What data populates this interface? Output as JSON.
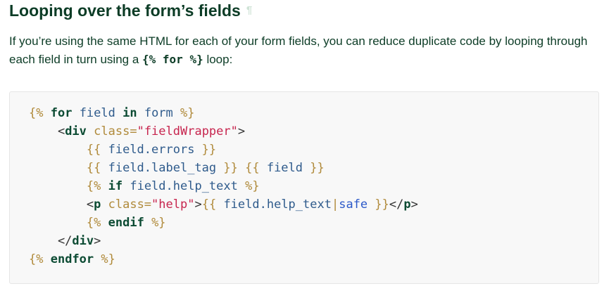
{
  "heading": {
    "text": "Looping over the form’s fields",
    "pilcrow": "¶"
  },
  "paragraph": {
    "before": "If you’re using the same HTML for each of your form fields, you can reduce duplicate code by looping through each field in turn using a ",
    "code": "{% for %}",
    "after": " loop:"
  },
  "code_lines": [
    [
      {
        "t": "tag",
        "v": "{%"
      },
      {
        "t": "txt",
        "v": " "
      },
      {
        "t": "kw",
        "v": "for"
      },
      {
        "t": "txt",
        "v": " field "
      },
      {
        "t": "kw",
        "v": "in"
      },
      {
        "t": "txt",
        "v": " form "
      },
      {
        "t": "tag",
        "v": "%}"
      }
    ],
    [
      {
        "t": "html",
        "v": "    <"
      },
      {
        "t": "el",
        "v": "div"
      },
      {
        "t": "html",
        "v": " "
      },
      {
        "t": "attr",
        "v": "class="
      },
      {
        "t": "str",
        "v": "\"fieldWrapper\""
      },
      {
        "t": "html",
        "v": ">"
      }
    ],
    [
      {
        "t": "txt",
        "v": "        "
      },
      {
        "t": "tag",
        "v": "{{"
      },
      {
        "t": "txt",
        "v": " field.errors "
      },
      {
        "t": "tag",
        "v": "}}"
      }
    ],
    [
      {
        "t": "txt",
        "v": "        "
      },
      {
        "t": "tag",
        "v": "{{"
      },
      {
        "t": "txt",
        "v": " field.label_tag "
      },
      {
        "t": "tag",
        "v": "}}"
      },
      {
        "t": "txt",
        "v": " "
      },
      {
        "t": "tag",
        "v": "{{"
      },
      {
        "t": "txt",
        "v": " field "
      },
      {
        "t": "tag",
        "v": "}}"
      }
    ],
    [
      {
        "t": "txt",
        "v": "        "
      },
      {
        "t": "tag",
        "v": "{%"
      },
      {
        "t": "txt",
        "v": " "
      },
      {
        "t": "kw",
        "v": "if"
      },
      {
        "t": "txt",
        "v": " field.help_text "
      },
      {
        "t": "tag",
        "v": "%}"
      }
    ],
    [
      {
        "t": "html",
        "v": "        <"
      },
      {
        "t": "el",
        "v": "p"
      },
      {
        "t": "html",
        "v": " "
      },
      {
        "t": "attr",
        "v": "class="
      },
      {
        "t": "str",
        "v": "\"help\""
      },
      {
        "t": "html",
        "v": ">"
      },
      {
        "t": "tag",
        "v": "{{"
      },
      {
        "t": "txt",
        "v": " field.help_text"
      },
      {
        "t": "tag",
        "v": "|"
      },
      {
        "t": "filter",
        "v": "safe"
      },
      {
        "t": "txt",
        "v": " "
      },
      {
        "t": "tag",
        "v": "}}"
      },
      {
        "t": "html",
        "v": "</"
      },
      {
        "t": "el",
        "v": "p"
      },
      {
        "t": "html",
        "v": ">"
      }
    ],
    [
      {
        "t": "txt",
        "v": "        "
      },
      {
        "t": "tag",
        "v": "{%"
      },
      {
        "t": "txt",
        "v": " "
      },
      {
        "t": "kw",
        "v": "endif"
      },
      {
        "t": "txt",
        "v": " "
      },
      {
        "t": "tag",
        "v": "%}"
      }
    ],
    [
      {
        "t": "html",
        "v": "    </"
      },
      {
        "t": "el",
        "v": "div"
      },
      {
        "t": "html",
        "v": ">"
      }
    ],
    [
      {
        "t": "tag",
        "v": "{%"
      },
      {
        "t": "txt",
        "v": " "
      },
      {
        "t": "kw",
        "v": "endfor"
      },
      {
        "t": "txt",
        "v": " "
      },
      {
        "t": "tag",
        "v": "%}"
      }
    ]
  ],
  "colors": {
    "heading": "#0c3c26",
    "template_tag": "#b08a3a",
    "keyword": "#0c4b33",
    "variable_text": "#2f5b8c",
    "string": "#c7254e",
    "filter": "#2b58c8"
  }
}
